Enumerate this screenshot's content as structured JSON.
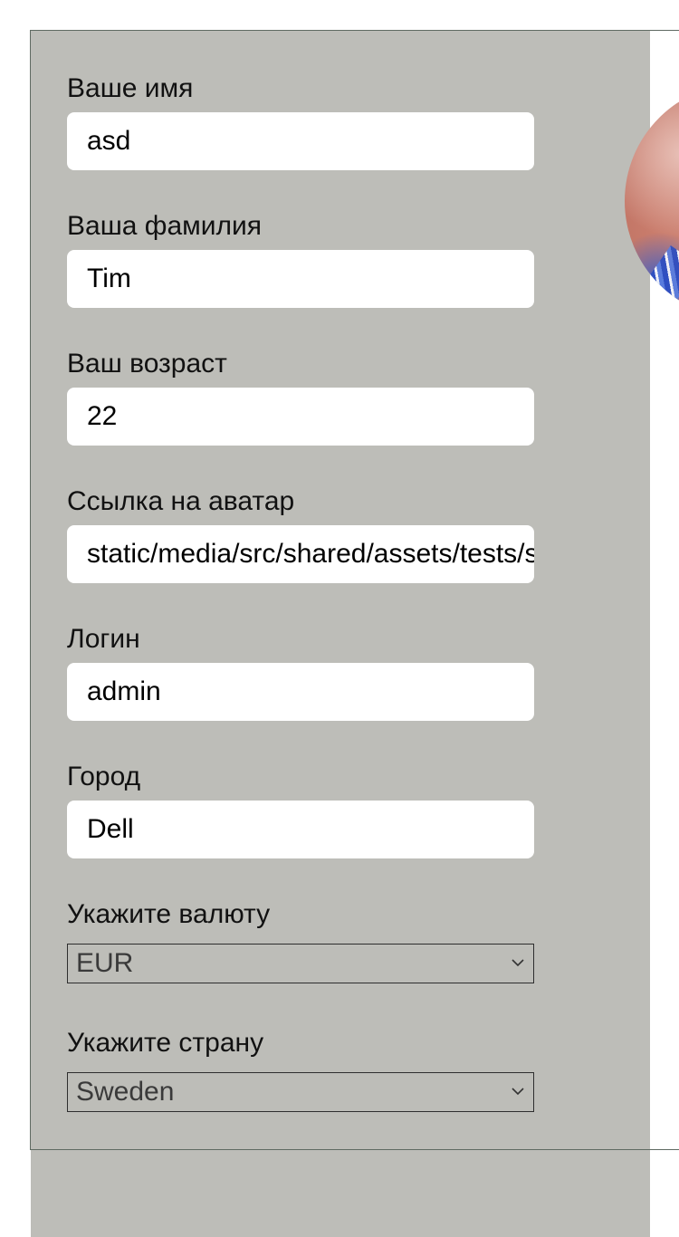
{
  "form": {
    "first_name": {
      "label": "Ваше имя",
      "value": "asd"
    },
    "last_name": {
      "label": "Ваша фамилия",
      "value": "Tim"
    },
    "age": {
      "label": "Ваш возраст",
      "value": "22"
    },
    "avatar_link": {
      "label": "Ссылка на аватар",
      "value": "static/media/src/shared/assets/tests/storybook.jpg"
    },
    "login": {
      "label": "Логин",
      "value": "admin"
    },
    "city": {
      "label": "Город",
      "value": "Dell"
    },
    "currency": {
      "label": "Укажите валюту",
      "selected": "EUR"
    },
    "country": {
      "label": "Укажите страну",
      "selected": "Sweden"
    }
  },
  "colors": {
    "panel_bg": "#bdbdb8",
    "input_bg": "#ffffff",
    "border": "#5f6a62"
  },
  "icons": {
    "select_arrow": "chevron-down-icon"
  }
}
